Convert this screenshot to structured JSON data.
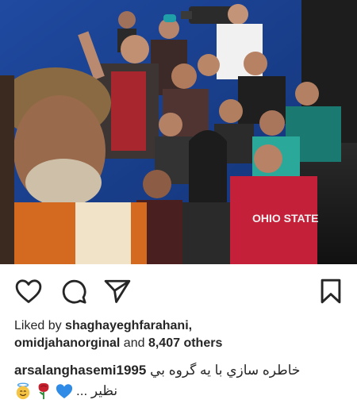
{
  "post": {
    "photo_alt": "Group selfie on a film set",
    "actions": {
      "like_icon": "heart-icon",
      "comment_icon": "comment-icon",
      "share_icon": "paper-plane-icon",
      "save_icon": "bookmark-icon"
    },
    "likes": {
      "prefix": "Liked by",
      "user1": "shaghayeghfarahani,",
      "user2": "omidjahanorginal",
      "connector": "and",
      "others": "8,407 others"
    },
    "caption": {
      "username": "arsalanghasemi1995",
      "text_line1": "خاطره سازي با يه گروه بي",
      "text_line2": "نظير ...",
      "emojis": [
        "blue-heart",
        "rose",
        "smiling-face-with-halo"
      ]
    }
  },
  "colors": {
    "text": "#262626",
    "background": "#ffffff",
    "blue_heart": "#2f8be6",
    "rose": "#c81f2d",
    "halo_face": "#f6c445"
  }
}
